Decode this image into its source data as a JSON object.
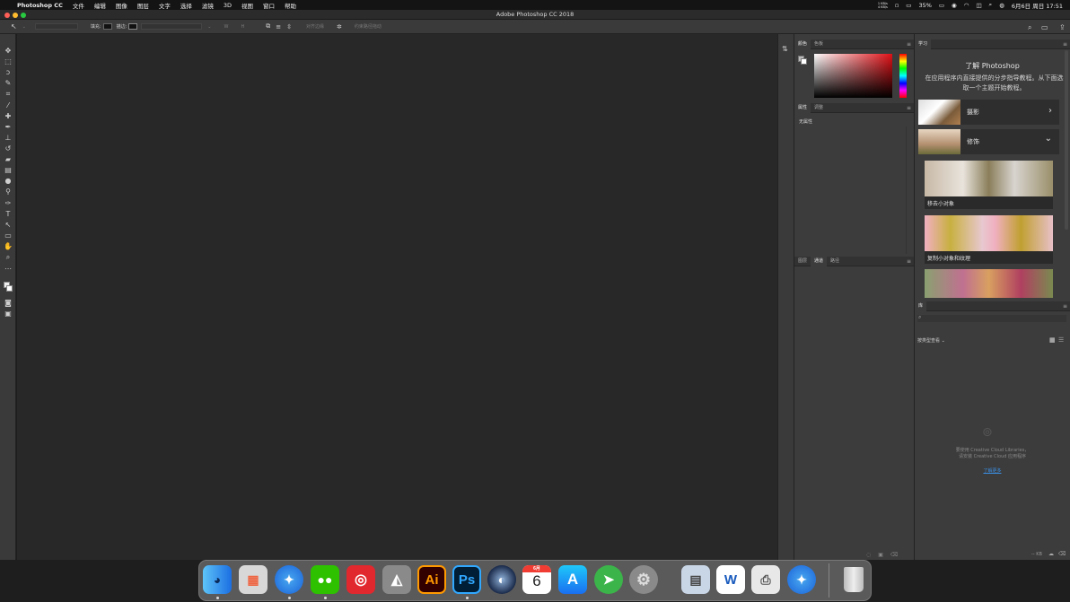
{
  "menubar": {
    "apple": "",
    "app_name": "Photoshop CC",
    "items": [
      "文件",
      "编辑",
      "图像",
      "图层",
      "文字",
      "选择",
      "滤镜",
      "3D",
      "视图",
      "窗口",
      "帮助"
    ],
    "status": {
      "network": "1 KB/s\n4 KB/s",
      "battery": "35%",
      "datetime": "6月6日 周日 17:51"
    }
  },
  "window": {
    "title": "Adobe Photoshop CC 2018"
  },
  "options_bar": {
    "fill_label": "填充:",
    "stroke_label": "描边:",
    "align_edges": "对齐边缘",
    "constrain_path": "约束路径拖动"
  },
  "panels": {
    "color": {
      "tabs": [
        "颜色",
        "色板"
      ],
      "active": "颜色",
      "accent": "#c8181e"
    },
    "properties": {
      "tabs": [
        "属性",
        "调整"
      ],
      "active": "属性",
      "empty_text": "无属性"
    },
    "layers": {
      "tabs": [
        "图层",
        "通道",
        "路径"
      ],
      "active": "通道"
    },
    "learn": {
      "tab": "学习",
      "title": "了解 Photoshop",
      "description": "在应用程序内直接提供的分步指导教程。从下面选取一个主题开始教程。",
      "categories": [
        {
          "label": "摄影",
          "chevron": "›"
        },
        {
          "label": "修饰",
          "chevron": "⌄"
        }
      ],
      "tutorials": [
        "移去小对象",
        "复制小对象和纹理"
      ]
    },
    "libraries": {
      "tab": "库",
      "view_label": "按类型查看",
      "empty_line1": "要使用 Creative Cloud Libraries，",
      "empty_line2": "请安装 Creative Cloud 应用程序",
      "link": "了解更多",
      "size": "-- KB"
    }
  },
  "dock": {
    "items": [
      {
        "name": "finder-icon",
        "label": ""
      },
      {
        "name": "launchpad-icon",
        "label": ""
      },
      {
        "name": "safari-icon",
        "label": ""
      },
      {
        "name": "wechat-icon",
        "label": ""
      },
      {
        "name": "netease-music-icon",
        "label": ""
      },
      {
        "name": "rhino-icon",
        "label": ""
      },
      {
        "name": "illustrator-icon",
        "label": "Ai"
      },
      {
        "name": "photoshop-icon",
        "label": "Ps"
      },
      {
        "name": "cinema4d-icon",
        "label": ""
      },
      {
        "name": "calendar-icon",
        "label": "6"
      },
      {
        "name": "app-store-icon",
        "label": ""
      },
      {
        "name": "telegram-icon",
        "label": ""
      },
      {
        "name": "system-preferences-icon",
        "label": ""
      },
      {
        "name": "preview-icon",
        "label": ""
      },
      {
        "name": "word-icon",
        "label": "W"
      },
      {
        "name": "printer-icon",
        "label": ""
      },
      {
        "name": "safari-2-icon",
        "label": ""
      },
      {
        "name": "trash-icon",
        "label": ""
      }
    ],
    "calendar_month": "6月"
  }
}
